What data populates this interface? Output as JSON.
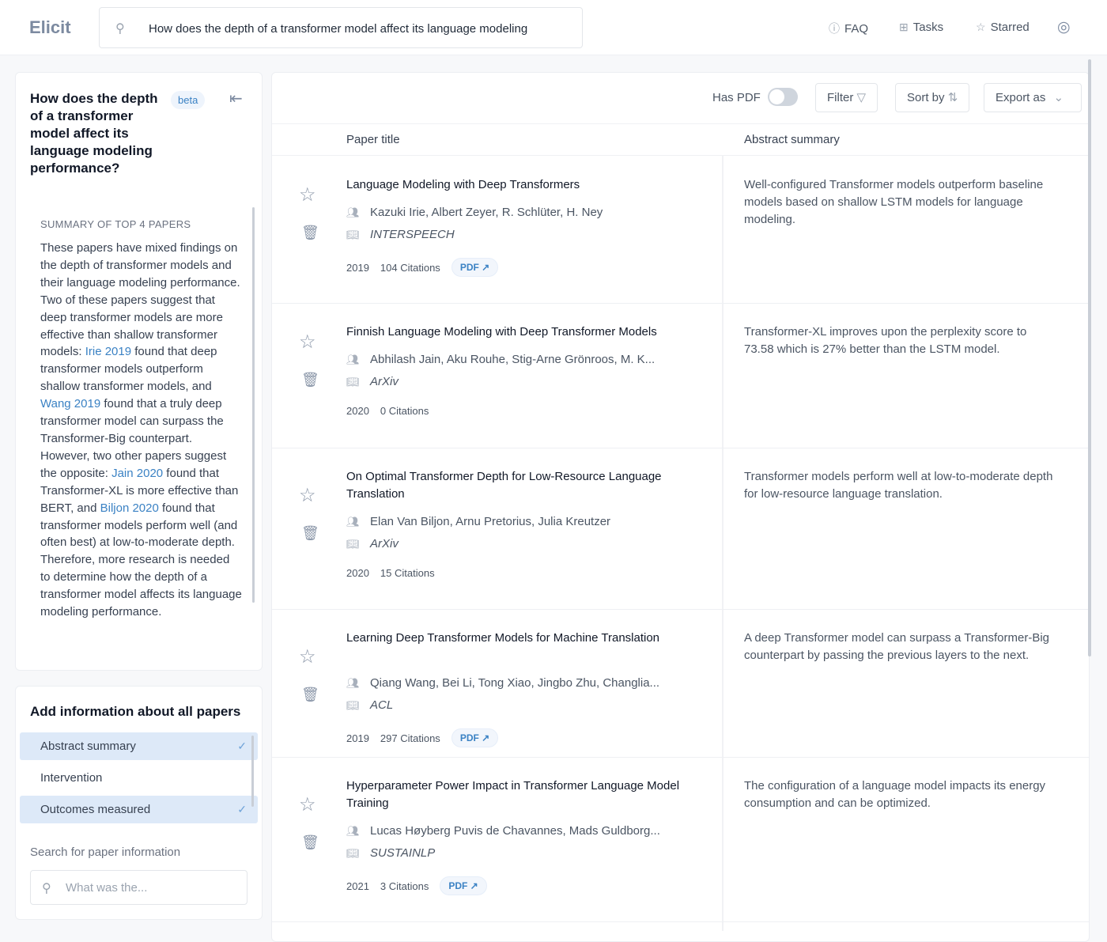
{
  "header": {
    "logo": "Elicit",
    "query": "How does the depth of a transformer model affect its language modeling",
    "nav": [
      {
        "label": "FAQ",
        "icon": "question-circle-icon"
      },
      {
        "label": "Tasks",
        "icon": "grid-icon"
      },
      {
        "label": "Starred",
        "icon": "star-icon"
      }
    ]
  },
  "sidebar": {
    "question": "How does the depth of a transformer model affect its language modeling performance?",
    "badge": "beta",
    "summary_heading": "SUMMARY OF TOP 4 PAPERS",
    "summary": [
      {
        "t": "These papers have mixed findings on the depth of transformer models and their language modeling performance. Two of these papers suggest that deep transformer models are more effective than shallow transformer models: "
      },
      {
        "link": "Irie 2019"
      },
      {
        "t": " found that deep transformer models outperform shallow transformer models, and "
      },
      {
        "link": "Wang 2019"
      },
      {
        "t": " found that a truly deep transformer model can surpass the Transformer-Big counterpart. However, two other papers suggest the opposite: "
      },
      {
        "link": "Jain 2020"
      },
      {
        "t": " found that Transformer-XL is more effective than BERT, and "
      },
      {
        "link": "Biljon 2020"
      },
      {
        "t": " found that transformer models perform well (and often best) at low-to-moderate depth. Therefore, more research is needed to determine how the depth of a transformer model affects its language modeling performance."
      }
    ],
    "add_info_heading": "Add information about all papers",
    "options": [
      {
        "label": "Abstract summary",
        "selected": true
      },
      {
        "label": "Intervention",
        "selected": false
      },
      {
        "label": "Outcomes measured",
        "selected": true
      }
    ],
    "search_label": "Search for paper information",
    "search_placeholder": "What was the..."
  },
  "toolbar": {
    "has_pdf": "Has PDF",
    "has_pdf_on": false,
    "filter": "Filter",
    "sort": "Sort by",
    "export": "Export as"
  },
  "table": {
    "columns": [
      "Paper title",
      "Abstract summary"
    ],
    "rows": [
      {
        "title": "Language Modeling with Deep Transformers",
        "authors": "Kazuki Irie, Albert Zeyer, R. Schlüter, H. Ney",
        "venue": "INTERSPEECH",
        "year": "2019",
        "citations": "104 Citations",
        "pdf": "PDF ↗",
        "summary": "Well-configured Transformer models outperform baseline models based on shallow LSTM models for language modeling."
      },
      {
        "title": "Finnish Language Modeling with Deep Transformer Models",
        "authors": "Abhilash Jain, Aku Rouhe, Stig-Arne Grönroos, M. K...",
        "venue": "ArXiv",
        "year": "2020",
        "citations": "0 Citations",
        "pdf": null,
        "summary": "Transformer-XL improves upon the perplexity score to 73.58 which is 27% better than the LSTM model."
      },
      {
        "title": "On Optimal Transformer Depth for Low-Resource Language Translation",
        "authors": "Elan Van Biljon, Arnu Pretorius, Julia Kreutzer",
        "venue": "ArXiv",
        "year": "2020",
        "citations": "15 Citations",
        "pdf": null,
        "summary": "Transformer models perform well at low-to-moderate depth for low-resource language translation."
      },
      {
        "title": "Learning Deep Transformer Models for Machine Translation",
        "authors": "Qiang Wang, Bei Li, Tong Xiao, Jingbo Zhu, Changlia...",
        "venue": "ACL",
        "year": "2019",
        "citations": "297 Citations",
        "pdf": "PDF ↗",
        "summary": "A deep Transformer model can surpass a Transformer-Big counterpart by passing the previous layers to the next."
      },
      {
        "title": "Hyperparameter Power Impact in Transformer Language Model Training",
        "authors": "Lucas Høyberg Puvis de Chavannes, Mads Guldborg...",
        "venue": "SUSTAINLP",
        "year": "2021",
        "citations": "3 Citations",
        "pdf": "PDF ↗",
        "summary": "The configuration of a language model impacts its energy consumption and can be optimized."
      }
    ]
  }
}
